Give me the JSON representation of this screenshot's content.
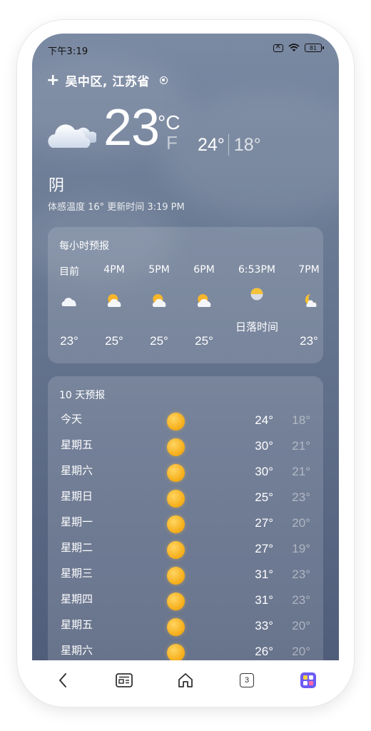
{
  "status_bar": {
    "time": "下午3:19",
    "battery": "81"
  },
  "location": {
    "name": "吴中区, 江苏省"
  },
  "current": {
    "temp": "23",
    "unit_c": "°C",
    "unit_f": "F",
    "high": "24°",
    "low": "18°",
    "condition": "阴",
    "feels_like": "体感温度 16°",
    "updated": "更新时间 3:19 PM"
  },
  "hourly": {
    "title": "每小时预报",
    "items": [
      {
        "time": "目前",
        "icon": "cloud-icon",
        "temp": "23°"
      },
      {
        "time": "4PM",
        "icon": "partly-cloudy-icon",
        "temp": "25°"
      },
      {
        "time": "5PM",
        "icon": "partly-cloudy-icon",
        "temp": "25°"
      },
      {
        "time": "6PM",
        "icon": "partly-cloudy-icon",
        "temp": "25°"
      },
      {
        "time": "6:53PM",
        "icon": "sunset-icon",
        "label": "日落时间"
      },
      {
        "time": "7PM",
        "icon": "moon-cloud-icon",
        "temp": "23°"
      }
    ]
  },
  "daily": {
    "title": "10 天预报",
    "items": [
      {
        "day": "今天",
        "icon": "sun-icon",
        "high": "24°",
        "low": "18°"
      },
      {
        "day": "星期五",
        "icon": "sun-icon",
        "high": "30°",
        "low": "21°"
      },
      {
        "day": "星期六",
        "icon": "sun-icon",
        "high": "30°",
        "low": "21°"
      },
      {
        "day": "星期日",
        "icon": "sun-icon",
        "high": "25°",
        "low": "23°"
      },
      {
        "day": "星期一",
        "icon": "sun-icon",
        "high": "27°",
        "low": "20°"
      },
      {
        "day": "星期二",
        "icon": "sun-icon",
        "high": "27°",
        "low": "19°"
      },
      {
        "day": "星期三",
        "icon": "sun-icon",
        "high": "31°",
        "low": "23°"
      },
      {
        "day": "星期四",
        "icon": "sun-icon",
        "high": "31°",
        "low": "23°"
      },
      {
        "day": "星期五",
        "icon": "sun-icon",
        "high": "33°",
        "low": "20°"
      },
      {
        "day": "星期六",
        "icon": "sun-icon",
        "high": "26°",
        "low": "20°"
      }
    ]
  },
  "nav": {
    "tab_count": "3"
  },
  "colors": {
    "sun": "#f6ae1a",
    "sky_top": "#7b8aa3",
    "sky_bottom": "#4e5b78",
    "nav_accent": "#3d6cf5"
  }
}
